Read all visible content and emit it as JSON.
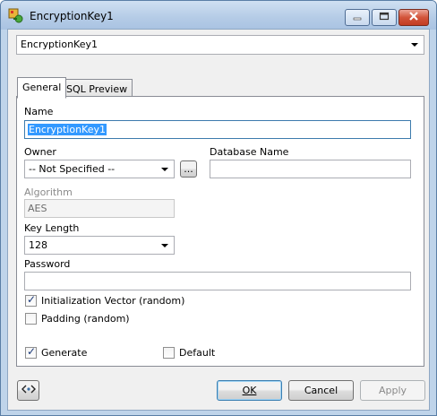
{
  "window": {
    "title": "EncryptionKey1",
    "controls": {
      "minimize": "minimize-icon",
      "maximize": "maximize-icon",
      "close": "close-icon"
    }
  },
  "object_selector": {
    "value": "EncryptionKey1"
  },
  "tabs": [
    {
      "label": "General",
      "active": true
    },
    {
      "label": "SQL Preview",
      "active": false
    }
  ],
  "form": {
    "name": {
      "label": "Name",
      "value": "EncryptionKey1"
    },
    "owner": {
      "label": "Owner",
      "value": "-- Not Specified --",
      "browse_label": "..."
    },
    "database_name": {
      "label": "Database Name",
      "value": ""
    },
    "algorithm": {
      "label": "Algorithm",
      "value": "AES",
      "enabled": false
    },
    "key_length": {
      "label": "Key Length",
      "value": "128"
    },
    "password": {
      "label": "Password",
      "value": ""
    },
    "initialization_vector": {
      "label": "Initialization Vector (random)",
      "checked": true
    },
    "padding": {
      "label": "Padding (random)",
      "checked": false
    },
    "generate": {
      "label": "Generate",
      "checked": true
    },
    "default": {
      "label": "Default",
      "checked": false
    }
  },
  "buttons": {
    "script_icon": "code-toggle-icon",
    "ok": "OK",
    "cancel": "Cancel",
    "apply": "Apply"
  },
  "colors": {
    "titlebar": "#b4cbe6",
    "close_button": "#c23b22",
    "selection": "#3399ff"
  }
}
